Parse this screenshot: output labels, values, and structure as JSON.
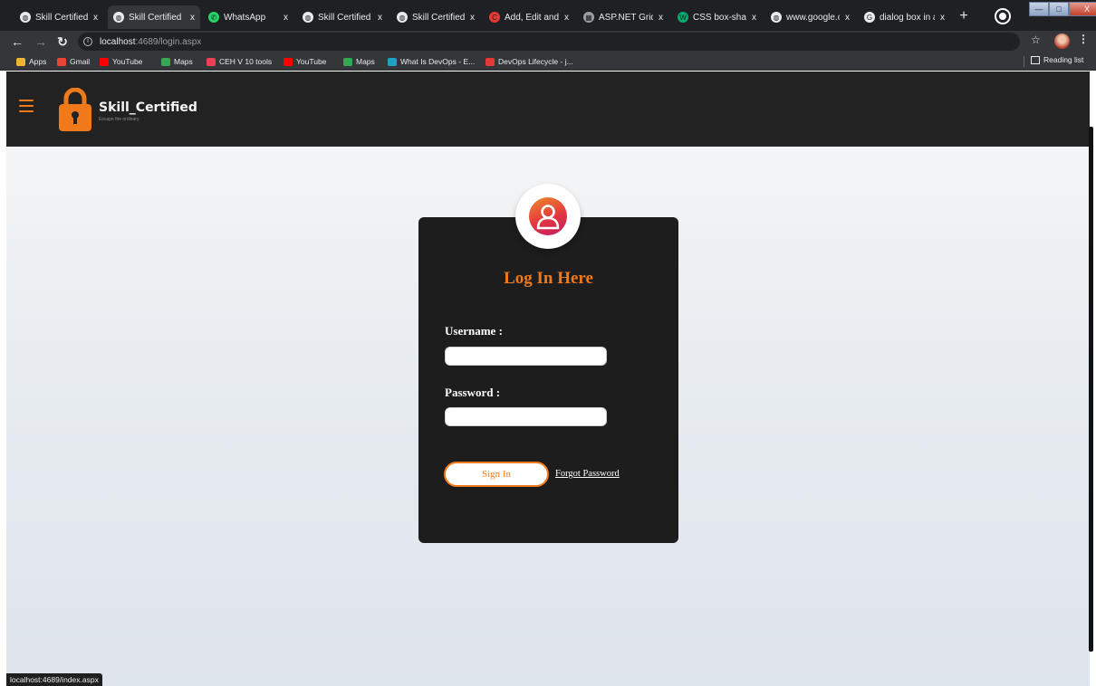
{
  "tabs": [
    {
      "label": "Skill Certified",
      "active": false,
      "icon": "globe-icon"
    },
    {
      "label": "Skill Certified |",
      "active": true,
      "icon": "globe-icon"
    },
    {
      "label": "WhatsApp",
      "active": false,
      "icon": "whatsapp-icon"
    },
    {
      "label": "Skill Certified",
      "active": false,
      "icon": "globe-icon"
    },
    {
      "label": "Skill Certified",
      "active": false,
      "icon": "globe-icon"
    },
    {
      "label": "Add, Edit and I",
      "active": false,
      "icon": "c-icon"
    },
    {
      "label": "ASP.NET GridV",
      "active": false,
      "icon": "grid-icon"
    },
    {
      "label": "CSS box-shad",
      "active": false,
      "icon": "w3-icon"
    },
    {
      "label": "www.google.c",
      "active": false,
      "icon": "globe-icon"
    },
    {
      "label": "dialog box in a",
      "active": false,
      "icon": "google-icon"
    }
  ],
  "tab_close": "x",
  "new_tab": "+",
  "window_controls": {
    "minimize": "—",
    "maximize": "□",
    "close": "X"
  },
  "address_bar": {
    "host": "localhost",
    "path": ":4689/login.aspx"
  },
  "bookmarks": [
    {
      "label": "Apps",
      "icon": "apps-grid-icon",
      "color": "#f2b233"
    },
    {
      "label": "Gmail",
      "icon": "gmail-icon",
      "color": "#ea4335"
    },
    {
      "label": "YouTube",
      "icon": "youtube-icon",
      "color": "#ff0000"
    },
    {
      "label": "Maps",
      "icon": "maps-icon",
      "color": "#34a853"
    },
    {
      "label": "CEH V 10 tools",
      "icon": "pocket-icon",
      "color": "#ef3f56"
    },
    {
      "label": "YouTube",
      "icon": "youtube-icon",
      "color": "#ff0000"
    },
    {
      "label": "Maps",
      "icon": "maps-icon",
      "color": "#34a853"
    },
    {
      "label": "What Is DevOps - E...",
      "icon": "devops-icon",
      "color": "#1aa3c4"
    },
    {
      "label": "DevOps Lifecycle - j...",
      "icon": "devops-v-icon",
      "color": "#e53935"
    }
  ],
  "reading_list": "Reading list",
  "site": {
    "brand_name": "Skill_Certified",
    "brand_tagline": "Escape the ordinary",
    "accent": "#f07a1a"
  },
  "login": {
    "title": "Log In Here",
    "username_label": "Username :",
    "username_value": "",
    "password_label": "Password :",
    "password_value": "",
    "signin_label": "Sign In",
    "forgot_label": "Forgot Password"
  },
  "status_url": "localhost:4689/index.aspx"
}
